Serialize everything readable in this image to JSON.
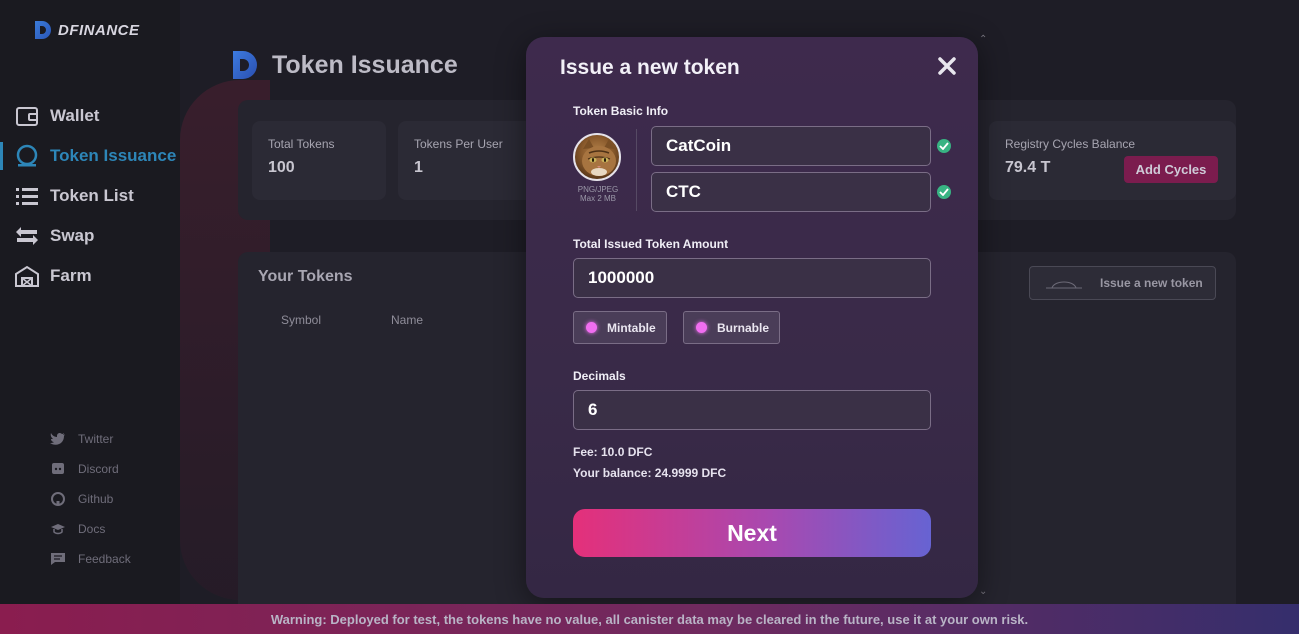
{
  "sidebar": {
    "brand": "DFINANCE",
    "items": [
      {
        "label": "Wallet",
        "icon": "wallet-icon"
      },
      {
        "label": "Token Issuance",
        "icon": "token-issuance-icon",
        "active": true
      },
      {
        "label": "Token List",
        "icon": "list-icon"
      },
      {
        "label": "Swap",
        "icon": "swap-icon"
      },
      {
        "label": "Farm",
        "icon": "farm-icon"
      }
    ],
    "social": [
      {
        "label": "Twitter",
        "icon": "twitter-icon"
      },
      {
        "label": "Discord",
        "icon": "discord-icon"
      },
      {
        "label": "Github",
        "icon": "github-icon"
      },
      {
        "label": "Docs",
        "icon": "docs-icon"
      },
      {
        "label": "Feedback",
        "icon": "feedback-icon"
      }
    ]
  },
  "page": {
    "title": "Token Issuance"
  },
  "stats": {
    "total_tokens_label": "Total Tokens",
    "total_tokens_value": "100",
    "tokens_per_user_label": "Tokens Per User",
    "tokens_per_user_value": "1",
    "registry_label": "Registry Cycles Balance",
    "registry_value": "79.4 T",
    "add_cycles_label": "Add Cycles"
  },
  "tokens": {
    "title": "Your Tokens",
    "columns": [
      "Symbol",
      "Name"
    ],
    "issue_button_label": "Issue a new token"
  },
  "modal": {
    "title": "Issue a new token",
    "basic_info_label": "Token Basic Info",
    "avatar_hint_line1": "PNG/JPEG",
    "avatar_hint_line2": "Max 2 MB",
    "name_value": "CatCoin",
    "symbol_value": "CTC",
    "amount_label": "Total Issued Token Amount",
    "amount_value": "1000000",
    "mintable_label": "Mintable",
    "burnable_label": "Burnable",
    "decimals_label": "Decimals",
    "decimals_value": "6",
    "fee_text": "Fee: 10.0 DFC",
    "balance_text": "Your balance: 24.9999 DFC",
    "next_label": "Next"
  },
  "warning": "Warning: Deployed for test, the tokens have no value, all canister data may be cleared in the future, use it at your own risk.",
  "colors": {
    "accent_blue": "#2d86b8",
    "check_green": "#38b383",
    "toggle_pink": "#f06ef0",
    "next_gradient_start": "#e4307a",
    "next_gradient_end": "#6763d2"
  }
}
